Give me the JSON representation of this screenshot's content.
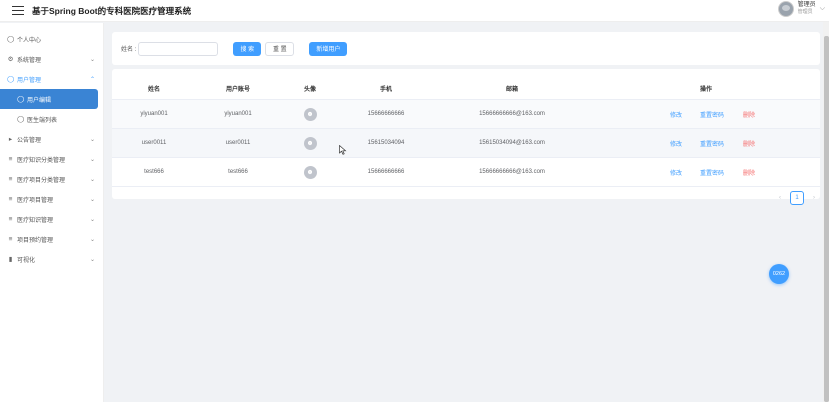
{
  "header": {
    "title": "基于Spring Boot的专科医院医疗管理系统",
    "user_name": "管理员",
    "user_role": "管理员"
  },
  "sidebar": {
    "items": [
      {
        "label": "个人中心",
        "icon": "user-icon"
      },
      {
        "label": "系统管理",
        "icon": "gear-icon"
      },
      {
        "label": "用户管理",
        "icon": "user-icon"
      },
      {
        "label": "用户编辑",
        "icon": "user-icon"
      },
      {
        "label": "医生端列表",
        "icon": "user-icon"
      },
      {
        "label": "公告管理",
        "icon": "speaker-icon"
      },
      {
        "label": "医疗知识分类管理",
        "icon": "list-icon"
      },
      {
        "label": "医疗项目分类管理",
        "icon": "list-icon"
      },
      {
        "label": "医疗项目管理",
        "icon": "list-icon"
      },
      {
        "label": "医疗知识管理",
        "icon": "list-icon"
      },
      {
        "label": "项目预约管理",
        "icon": "list-icon"
      },
      {
        "label": "可视化",
        "icon": "chart-icon"
      }
    ]
  },
  "search": {
    "label": "姓名 :",
    "value": "",
    "search_button": "搜 索",
    "reset_button": "重 置",
    "add_button": "新增用户"
  },
  "table": {
    "headers": [
      "姓名",
      "用户账号",
      "头像",
      "手机",
      "邮箱",
      "操作"
    ],
    "rows": [
      {
        "name": "yiyuan001",
        "account": "yiyuan001",
        "phone": "15666666666",
        "email": "15666666666@163.com",
        "edit": "修改",
        "reset_pwd": "重置密码",
        "delete": "删除"
      },
      {
        "name": "user0011",
        "account": "user0011",
        "phone": "15615034094",
        "email": "15615034094@163.com",
        "edit": "修改",
        "reset_pwd": "重置密码",
        "delete": "删除"
      },
      {
        "name": "test666",
        "account": "test666",
        "phone": "15666666666",
        "email": "15666666666@163.com",
        "edit": "修改",
        "reset_pwd": "重置密码",
        "delete": "删除"
      }
    ]
  },
  "pagination": {
    "current_page": "1",
    "prev": "‹",
    "next": "›"
  },
  "float_button": {
    "label": "0262"
  },
  "colors": {
    "primary": "#409eff",
    "danger": "#f56c6c",
    "active_menu": "#3a84d4"
  }
}
